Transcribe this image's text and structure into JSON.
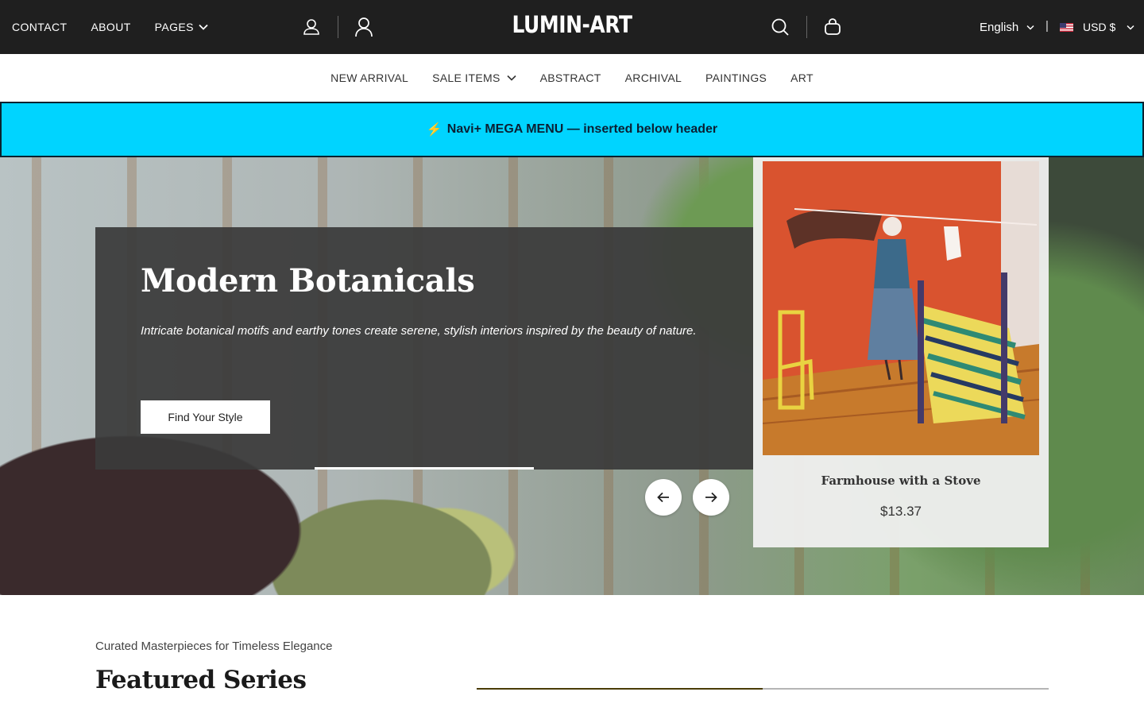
{
  "topbar": {
    "nav": [
      {
        "label": "CONTACT"
      },
      {
        "label": "ABOUT"
      },
      {
        "label": "PAGES"
      }
    ],
    "logo": "LUMIN-ART",
    "language": "English",
    "separator": "|",
    "currency": "USD $"
  },
  "mainnav": {
    "items": [
      {
        "label": "NEW ARRIVAL"
      },
      {
        "label": "SALE ITEMS"
      },
      {
        "label": "ABSTRACT"
      },
      {
        "label": "ARCHIVAL"
      },
      {
        "label": "PAINTINGS"
      },
      {
        "label": "ART"
      }
    ]
  },
  "banner": {
    "icon": "⚡",
    "text": "Navi+ MEGA MENU — inserted below header",
    "background_color": "#00d4ff"
  },
  "hero": {
    "title": "Modern Botanicals",
    "subtitle": "Intricate botanical motifs and earthy tones create serene, stylish interiors inspired by the beauty of nature.",
    "cta_label": "Find Your Style",
    "slide_progress": 0.33
  },
  "product": {
    "name": "Farmhouse with a Stove",
    "price": "$13.37"
  },
  "featured": {
    "subtitle": "Curated Masterpieces for Timeless Elegance",
    "title": "Featured Series",
    "scroll_progress": 0.5,
    "progress_color": "#4a3b05"
  }
}
